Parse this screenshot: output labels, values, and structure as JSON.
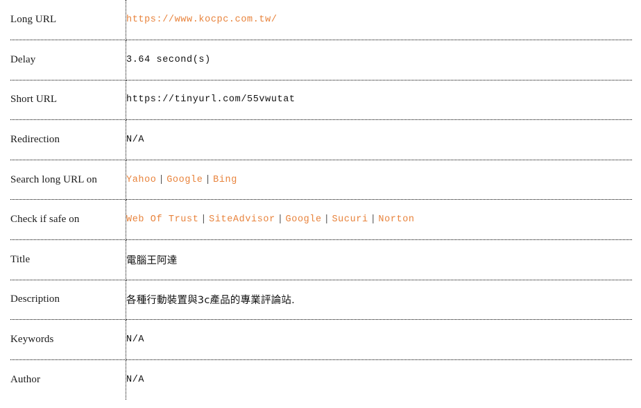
{
  "table": {
    "rows": [
      {
        "label": "Long URL",
        "type": "link",
        "value": "https://www.kocpc.com.tw/"
      },
      {
        "label": "Delay",
        "type": "plain",
        "value": "3.64 second(s)"
      },
      {
        "label": "Short URL",
        "type": "plain",
        "value": "https://tinyurl.com/55vwutat"
      },
      {
        "label": "Redirection",
        "type": "plain",
        "value": "N/A"
      },
      {
        "label": "Search long URL on",
        "type": "link-list",
        "links": [
          "Yahoo",
          "Google",
          "Bing"
        ],
        "separator": "|"
      },
      {
        "label": "Check if safe on",
        "type": "link-list",
        "links": [
          "Web Of Trust",
          "SiteAdvisor",
          "Google",
          "Sucuri",
          "Norton"
        ],
        "separator": "|"
      },
      {
        "label": "Title",
        "type": "cjk",
        "value": "電腦王阿達"
      },
      {
        "label": "Description",
        "type": "cjk",
        "value": "各種行動裝置與3c產品的專業評論站."
      },
      {
        "label": "Keywords",
        "type": "plain",
        "value": "N/A"
      },
      {
        "label": "Author",
        "type": "plain",
        "value": "N/A"
      }
    ]
  },
  "colors": {
    "link": "#e8833c",
    "text": "#111111",
    "separator": "#555555",
    "border": "#000000",
    "background": "#ffffff"
  }
}
